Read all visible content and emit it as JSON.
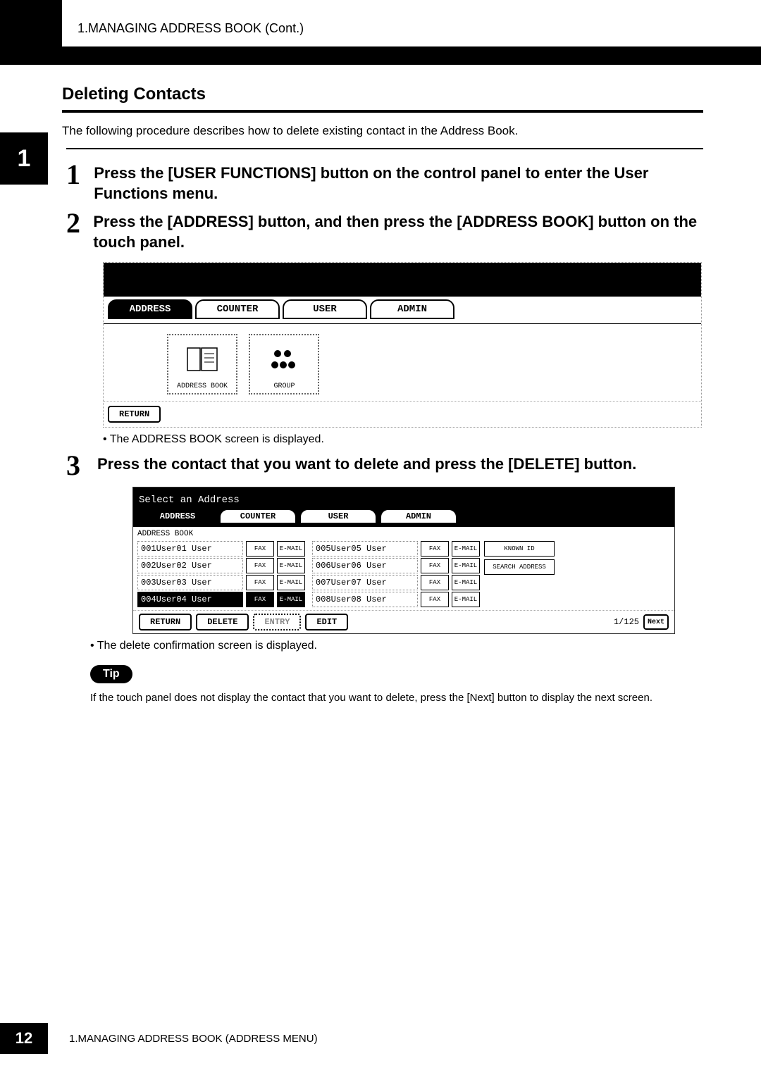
{
  "header": {
    "breadcrumb": "1.MANAGING ADDRESS BOOK (Cont.)"
  },
  "side_tab": "1",
  "section_title": "Deleting Contacts",
  "intro": "The following procedure describes how to delete existing contact in the Address Book.",
  "steps": {
    "s1": {
      "num": "1",
      "text": "Press the [USER FUNCTIONS] button on the control panel to enter the User Functions menu."
    },
    "s2": {
      "num": "2",
      "text": "Press the [ADDRESS] button, and then press the [ADDRESS BOOK] button on the touch panel."
    },
    "s3": {
      "num": "3",
      "text": "Press the contact that you want to delete and press the [DELETE] button."
    }
  },
  "screen1": {
    "tabs": {
      "address": "ADDRESS",
      "counter": "COUNTER",
      "user": "USER",
      "admin": "ADMIN"
    },
    "address_book_btn": "ADDRESS BOOK",
    "group_btn": "GROUP",
    "return_btn": "RETURN"
  },
  "note_after_screen1": "The ADDRESS BOOK screen is displayed.",
  "screen2": {
    "prompt": "Select an Address",
    "tabs": {
      "address": "ADDRESS",
      "counter": "COUNTER",
      "user": "USER",
      "admin": "ADMIN"
    },
    "list_label": "ADDRESS BOOK",
    "known_id_btn": "KNOWN ID",
    "search_address_btn": "SEARCH ADDRESS",
    "rows_left": [
      {
        "id": "001",
        "name": "User01 User",
        "selected": false
      },
      {
        "id": "002",
        "name": "User02 User",
        "selected": false
      },
      {
        "id": "003",
        "name": "User03 User",
        "selected": false
      },
      {
        "id": "004",
        "name": "User04 User",
        "selected": true
      }
    ],
    "rows_right": [
      {
        "id": "005",
        "name": "User05 User"
      },
      {
        "id": "006",
        "name": "User06 User"
      },
      {
        "id": "007",
        "name": "User07 User"
      },
      {
        "id": "008",
        "name": "User08 User"
      }
    ],
    "fax_label": "FAX",
    "email_label": "E-MAIL",
    "footer": {
      "return": "RETURN",
      "delete": "DELETE",
      "entry": "ENTRY",
      "edit": "EDIT",
      "page_indicator": "1/125",
      "next": "Next"
    }
  },
  "note_after_screen2": "The delete confirmation screen is displayed.",
  "tip": {
    "label": "Tip",
    "text": "If the touch panel does not display the contact that you want to delete, press the [Next] button to display the next screen."
  },
  "footer": {
    "page_number": "12",
    "text": "1.MANAGING ADDRESS BOOK (ADDRESS MENU)"
  }
}
